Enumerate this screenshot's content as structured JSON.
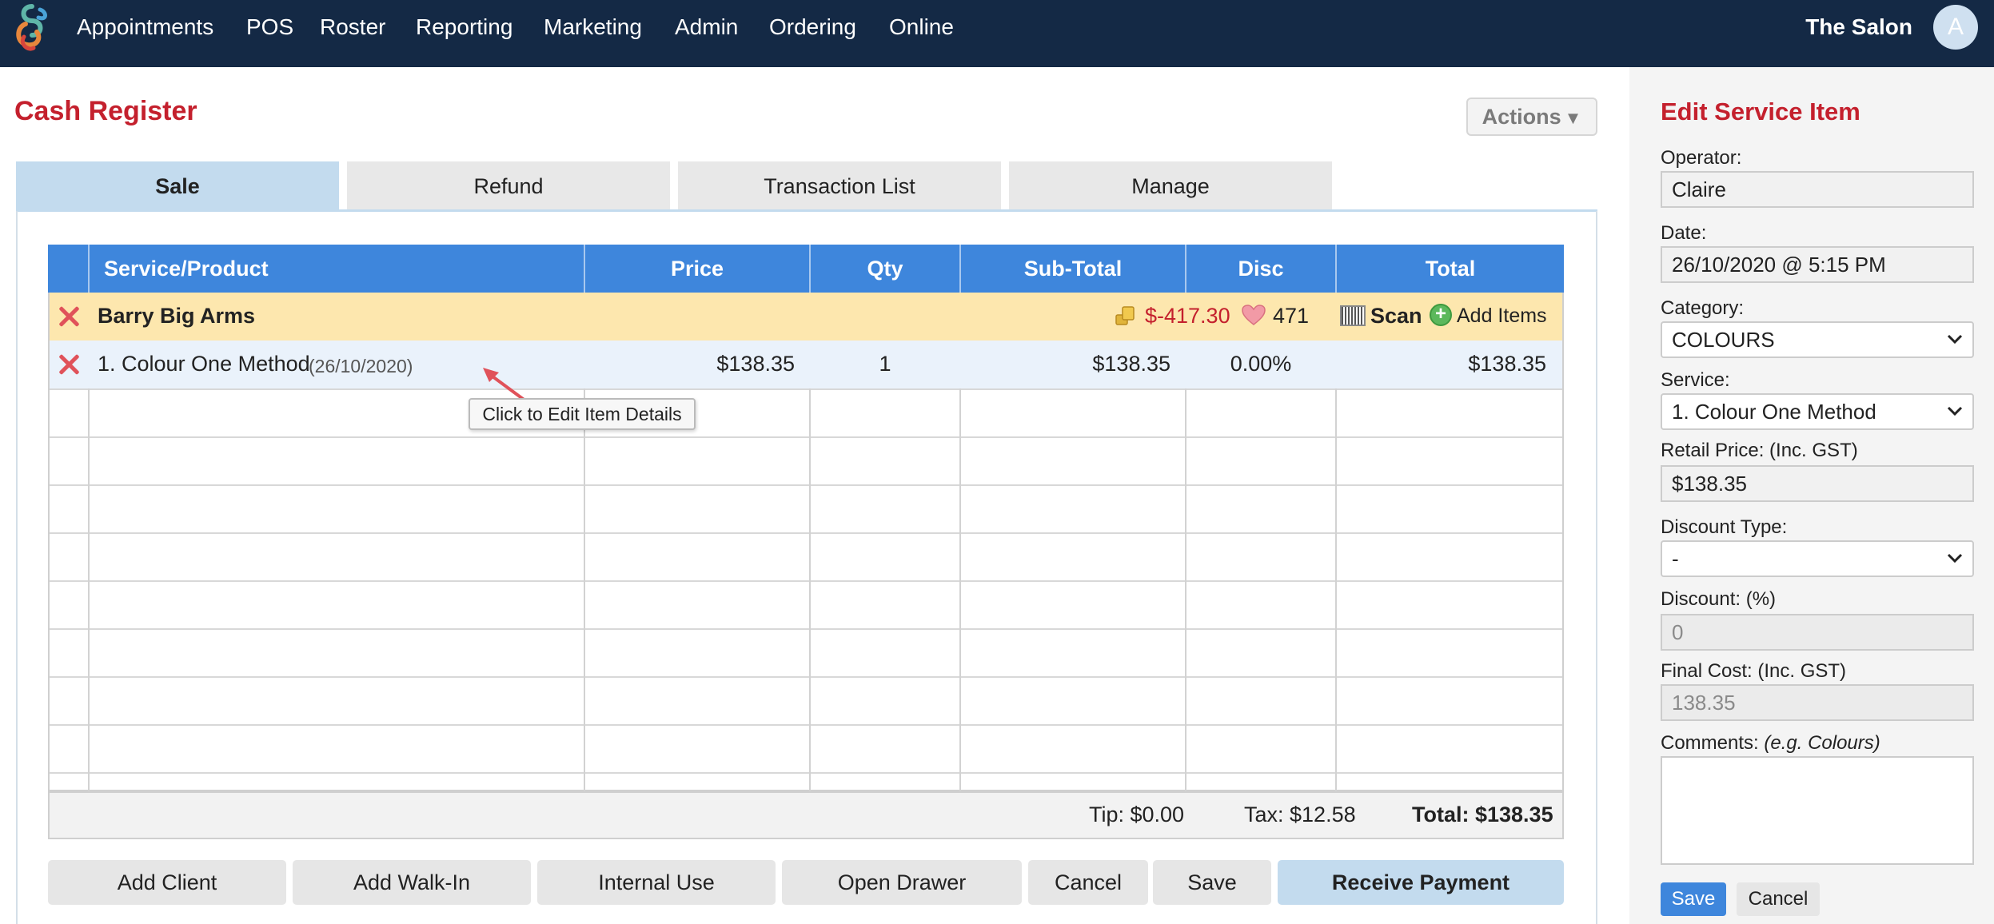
{
  "nav": {
    "items": [
      "Appointments",
      "POS",
      "Roster",
      "Reporting",
      "Marketing",
      "Admin",
      "Ordering",
      "Online"
    ],
    "salon_name": "The Salon",
    "avatar_initial": "A"
  },
  "page": {
    "title": "Cash Register",
    "actions_label": "Actions"
  },
  "tabs": [
    "Sale",
    "Refund",
    "Transaction List",
    "Manage"
  ],
  "table": {
    "headers": [
      "Service/Product",
      "Price",
      "Qty",
      "Sub-Total",
      "Disc",
      "Total"
    ],
    "client": {
      "name": "Barry Big Arms",
      "balance": "$-417.30",
      "loyalty_points": "471",
      "scan_label": "Scan",
      "add_items_label": "Add Items"
    },
    "items": [
      {
        "name": "1. Colour One Method",
        "date": "(26/10/2020)",
        "price": "$138.35",
        "qty": "1",
        "subtotal": "$138.35",
        "disc": "0.00%",
        "total": "$138.35"
      }
    ],
    "tooltip": "Click to Edit Item Details",
    "footer": {
      "tip": "Tip: $0.00",
      "tax": "Tax: $12.58",
      "total": "Total: $138.35"
    }
  },
  "buttons": {
    "add_client": "Add Client",
    "add_walkin": "Add Walk-In",
    "internal_use": "Internal Use",
    "open_drawer": "Open Drawer",
    "cancel": "Cancel",
    "save": "Save",
    "receive_payment": "Receive Payment"
  },
  "edit_panel": {
    "title": "Edit Service Item",
    "operator_label": "Operator:",
    "operator_value": "Claire",
    "date_label": "Date:",
    "date_value": "26/10/2020 @ 5:15 PM",
    "category_label": "Category:",
    "category_value": "COLOURS",
    "service_label": "Service:",
    "service_value": "1. Colour One Method",
    "retail_price_label": "Retail Price: (Inc. GST)",
    "retail_price_value": "$138.35",
    "discount_type_label": "Discount Type:",
    "discount_type_value": "-",
    "discount_label": "Discount: (%)",
    "discount_value": "0",
    "final_cost_label": "Final Cost: (Inc. GST)",
    "final_cost_value": "138.35",
    "comments_label": "Comments:",
    "comments_hint": "(e.g. Colours)",
    "save_label": "Save",
    "cancel_label": "Cancel"
  },
  "colors": {
    "nav_bg": "#142945",
    "accent_red": "#c4202d",
    "header_blue": "#3e86dc",
    "client_row": "#fde7ae",
    "primary_button": "#c3dbee"
  }
}
